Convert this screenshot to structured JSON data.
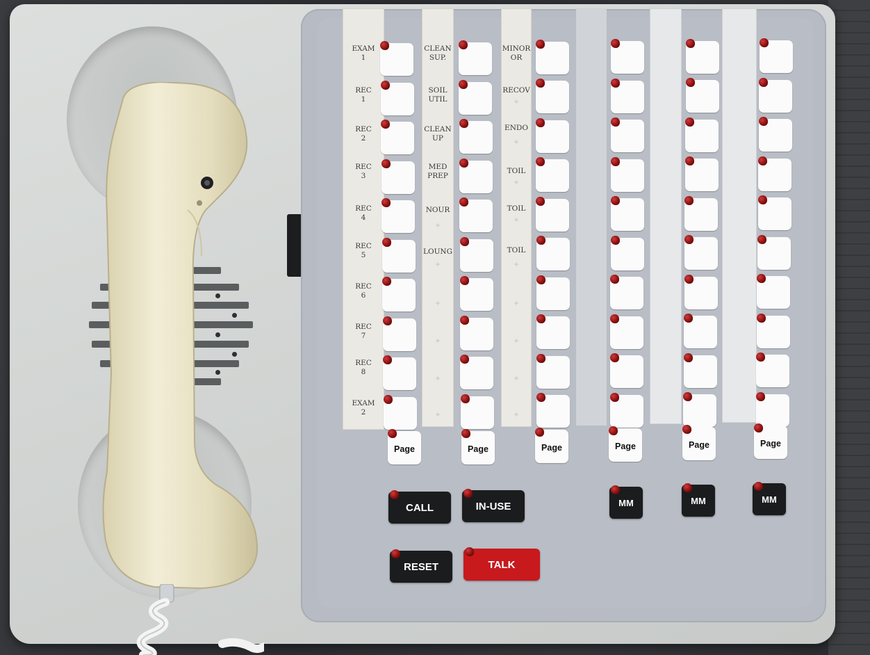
{
  "intercom": {
    "column_labels": [
      [
        "EXAM\n1",
        "REC\n1",
        "REC\n2",
        "REC\n3",
        "REC\n4",
        "REC\n5",
        "REC\n6",
        "REC\n7",
        "REC\n8",
        "EXAM\n2"
      ],
      [
        "CLEAN\nSUP.",
        "SOIL\nUTIL",
        "CLEAN\nUP",
        "MED\nPREP",
        "NOUR",
        "LOUNG",
        "",
        "",
        "",
        ""
      ],
      [
        "MINOR\nOR",
        "RECOV",
        "ENDO",
        "TOIL",
        "TOIL",
        "TOIL",
        "",
        "",
        "",
        ""
      ]
    ],
    "plus_mark": "+",
    "page_label": "Page",
    "buttons": {
      "call": "CALL",
      "in_use": "IN-USE",
      "reset": "RESET",
      "talk": "TALK",
      "mm": "MM"
    },
    "colors": {
      "led_red": "#8a1010",
      "talk_red": "#c8191d",
      "handset_beige": "#e8e2c4",
      "panel_gray": "#b9bdc5"
    }
  }
}
